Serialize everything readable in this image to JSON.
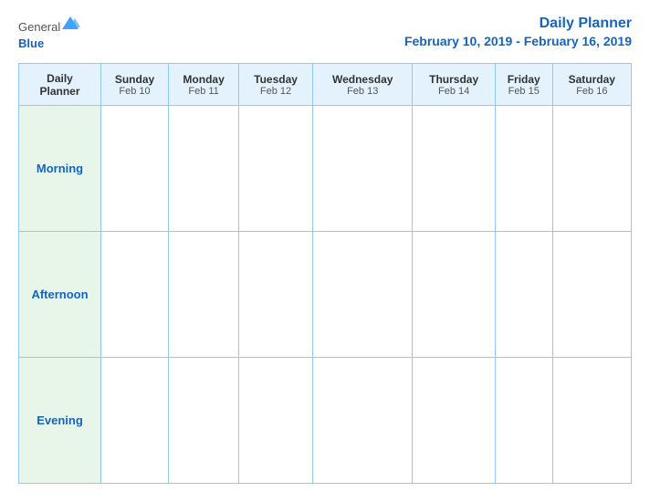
{
  "header": {
    "logo": {
      "general": "General",
      "blue": "Blue"
    },
    "title": "Daily Planner",
    "date_range": "February 10, 2019 - February 16, 2019"
  },
  "table": {
    "label_header": "Daily\nPlanner",
    "days": [
      {
        "name": "Sunday",
        "date": "Feb 10"
      },
      {
        "name": "Monday",
        "date": "Feb 11"
      },
      {
        "name": "Tuesday",
        "date": "Feb 12"
      },
      {
        "name": "Wednesday",
        "date": "Feb 13"
      },
      {
        "name": "Thursday",
        "date": "Feb 14"
      },
      {
        "name": "Friday",
        "date": "Feb 15"
      },
      {
        "name": "Saturday",
        "date": "Feb 16"
      }
    ],
    "rows": [
      {
        "label": "Morning"
      },
      {
        "label": "Afternoon"
      },
      {
        "label": "Evening"
      }
    ]
  }
}
